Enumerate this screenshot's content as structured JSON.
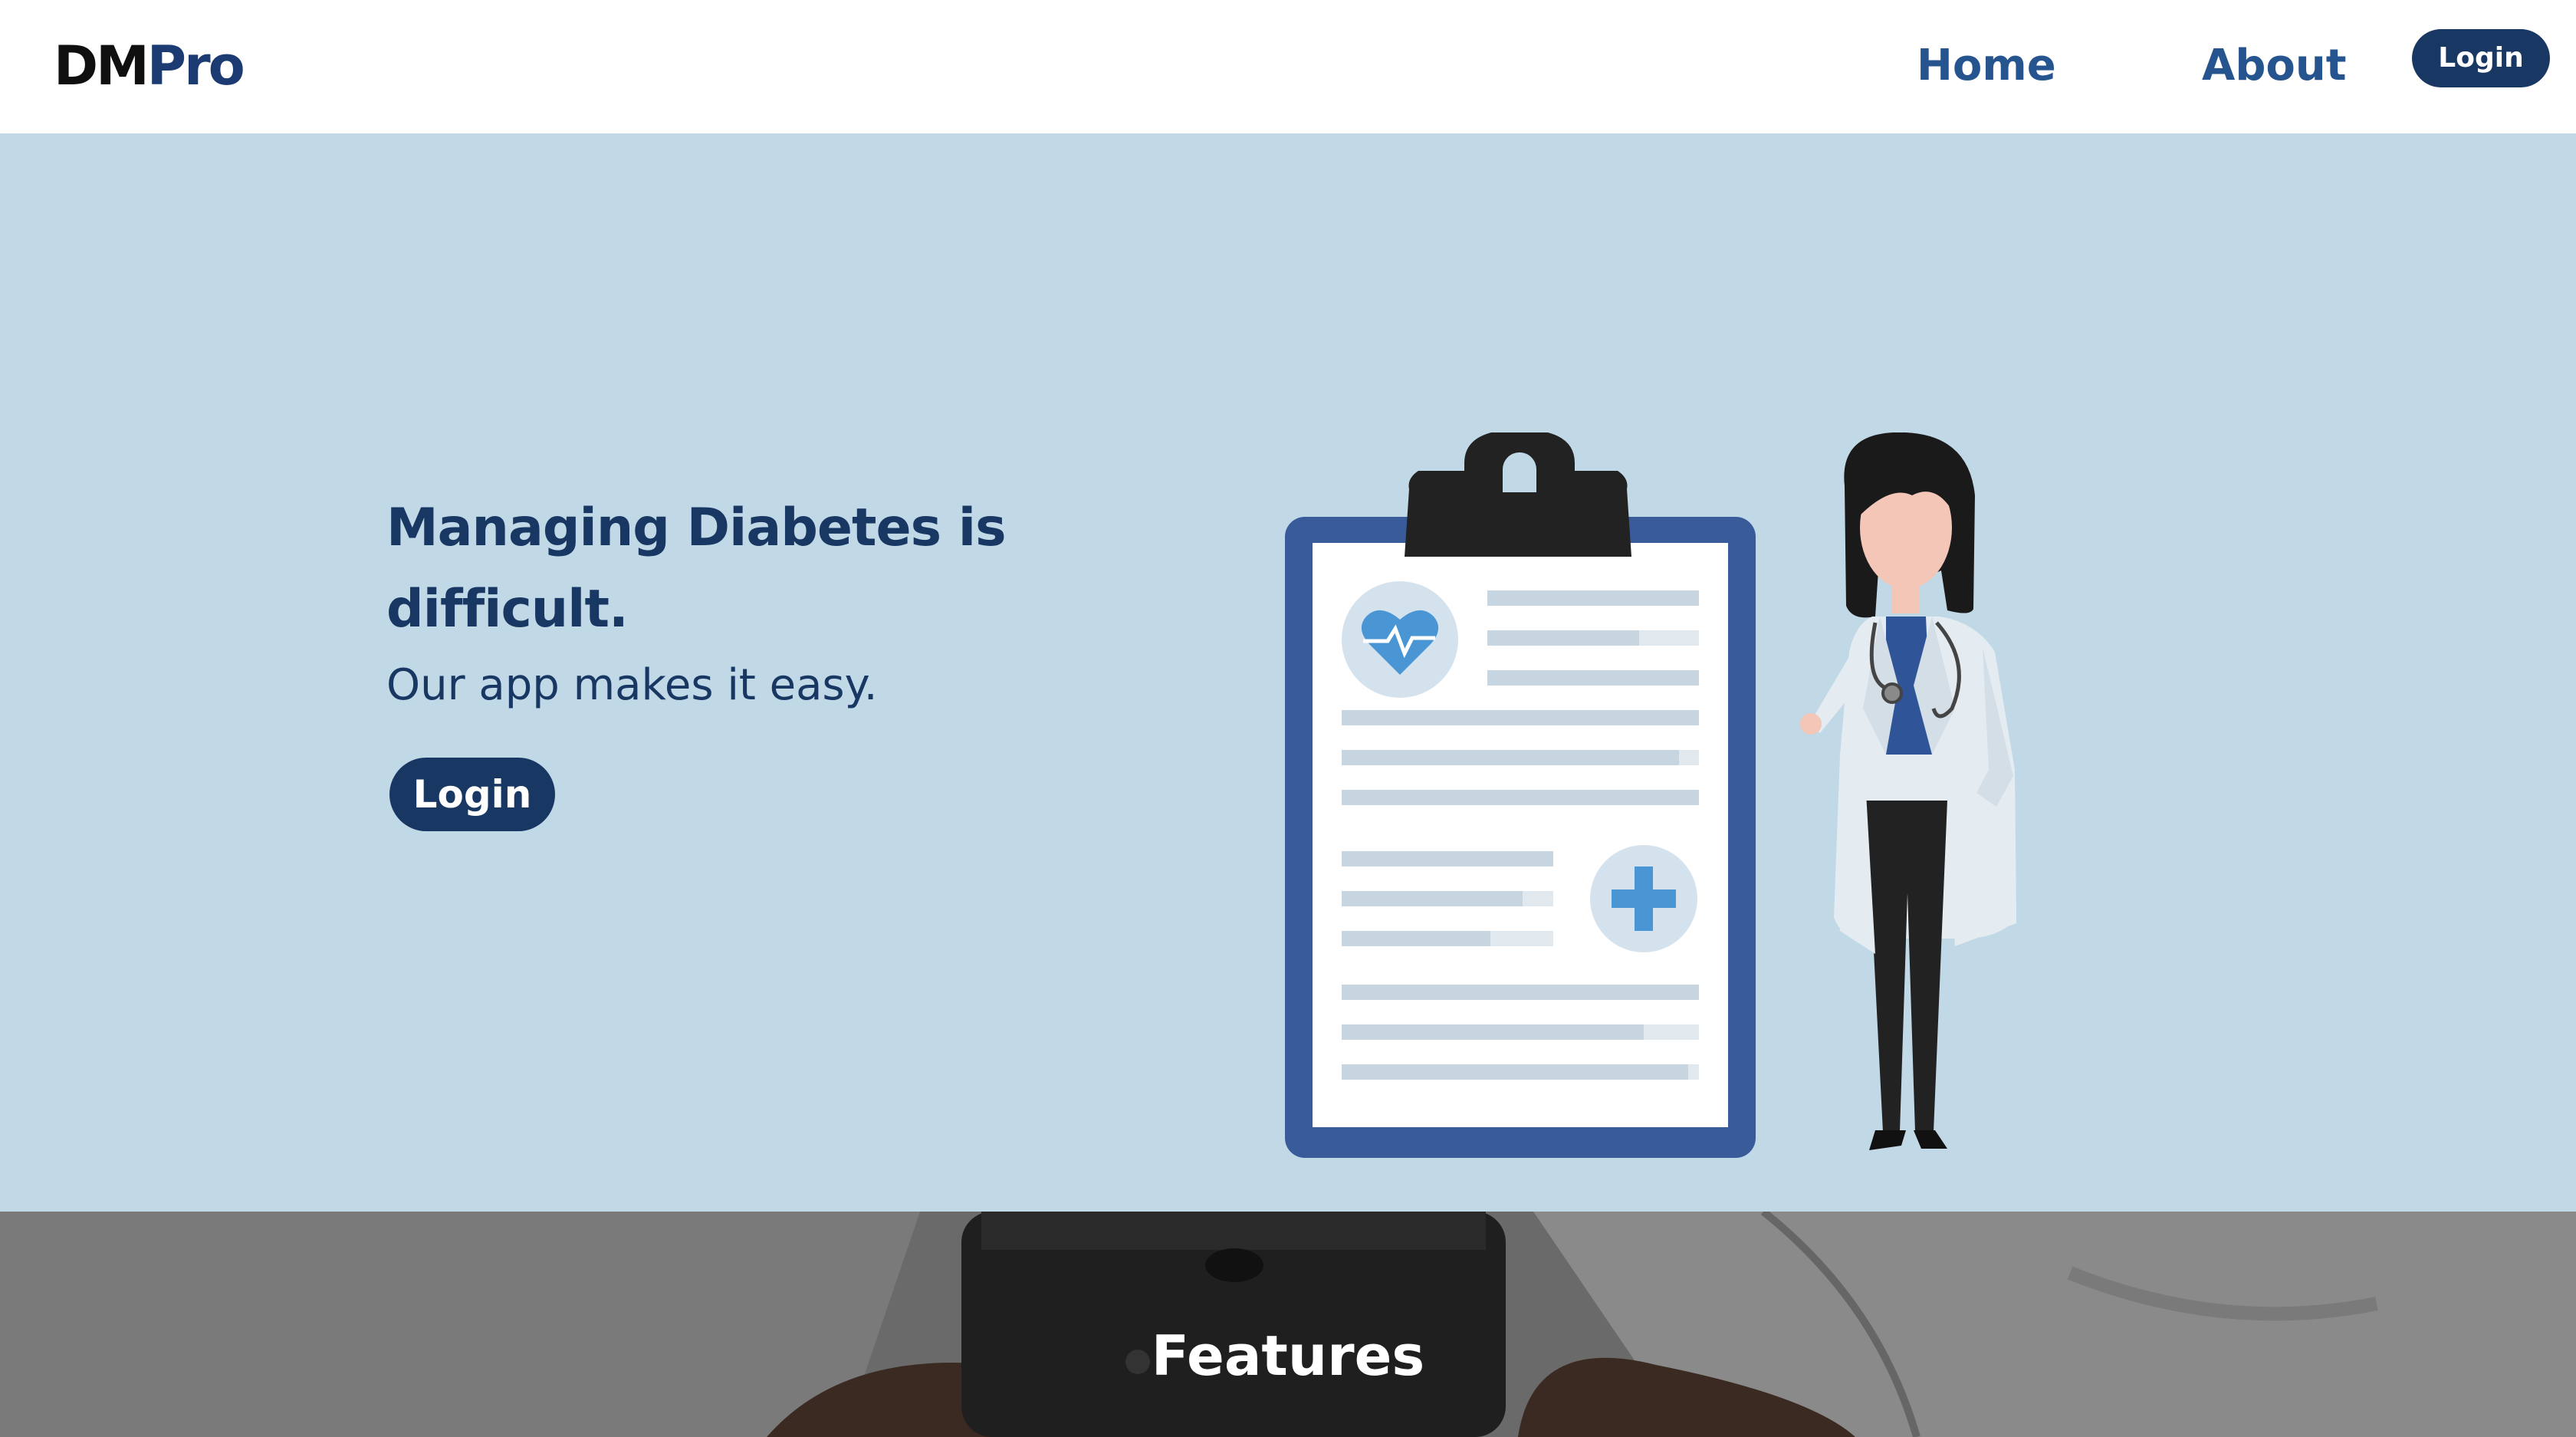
{
  "header": {
    "brand_dm": "DM",
    "brand_pro": "Pro",
    "nav": {
      "home": "Home",
      "about": "About",
      "login": "Login"
    }
  },
  "hero": {
    "title": "Managing Diabetes is difficult.",
    "subtitle": "Our app makes it easy.",
    "login": "Login",
    "illustration_icons": [
      "heart-pulse-icon",
      "medical-cross-icon",
      "clipboard",
      "doctor-figure"
    ]
  },
  "features": {
    "title": "Features"
  },
  "colors": {
    "navy": "#183763",
    "link_blue": "#25548f",
    "hero_bg": "#c1d8e7",
    "clipboard_blue": "#3a5b99",
    "accent_blue": "#4a96d4"
  }
}
